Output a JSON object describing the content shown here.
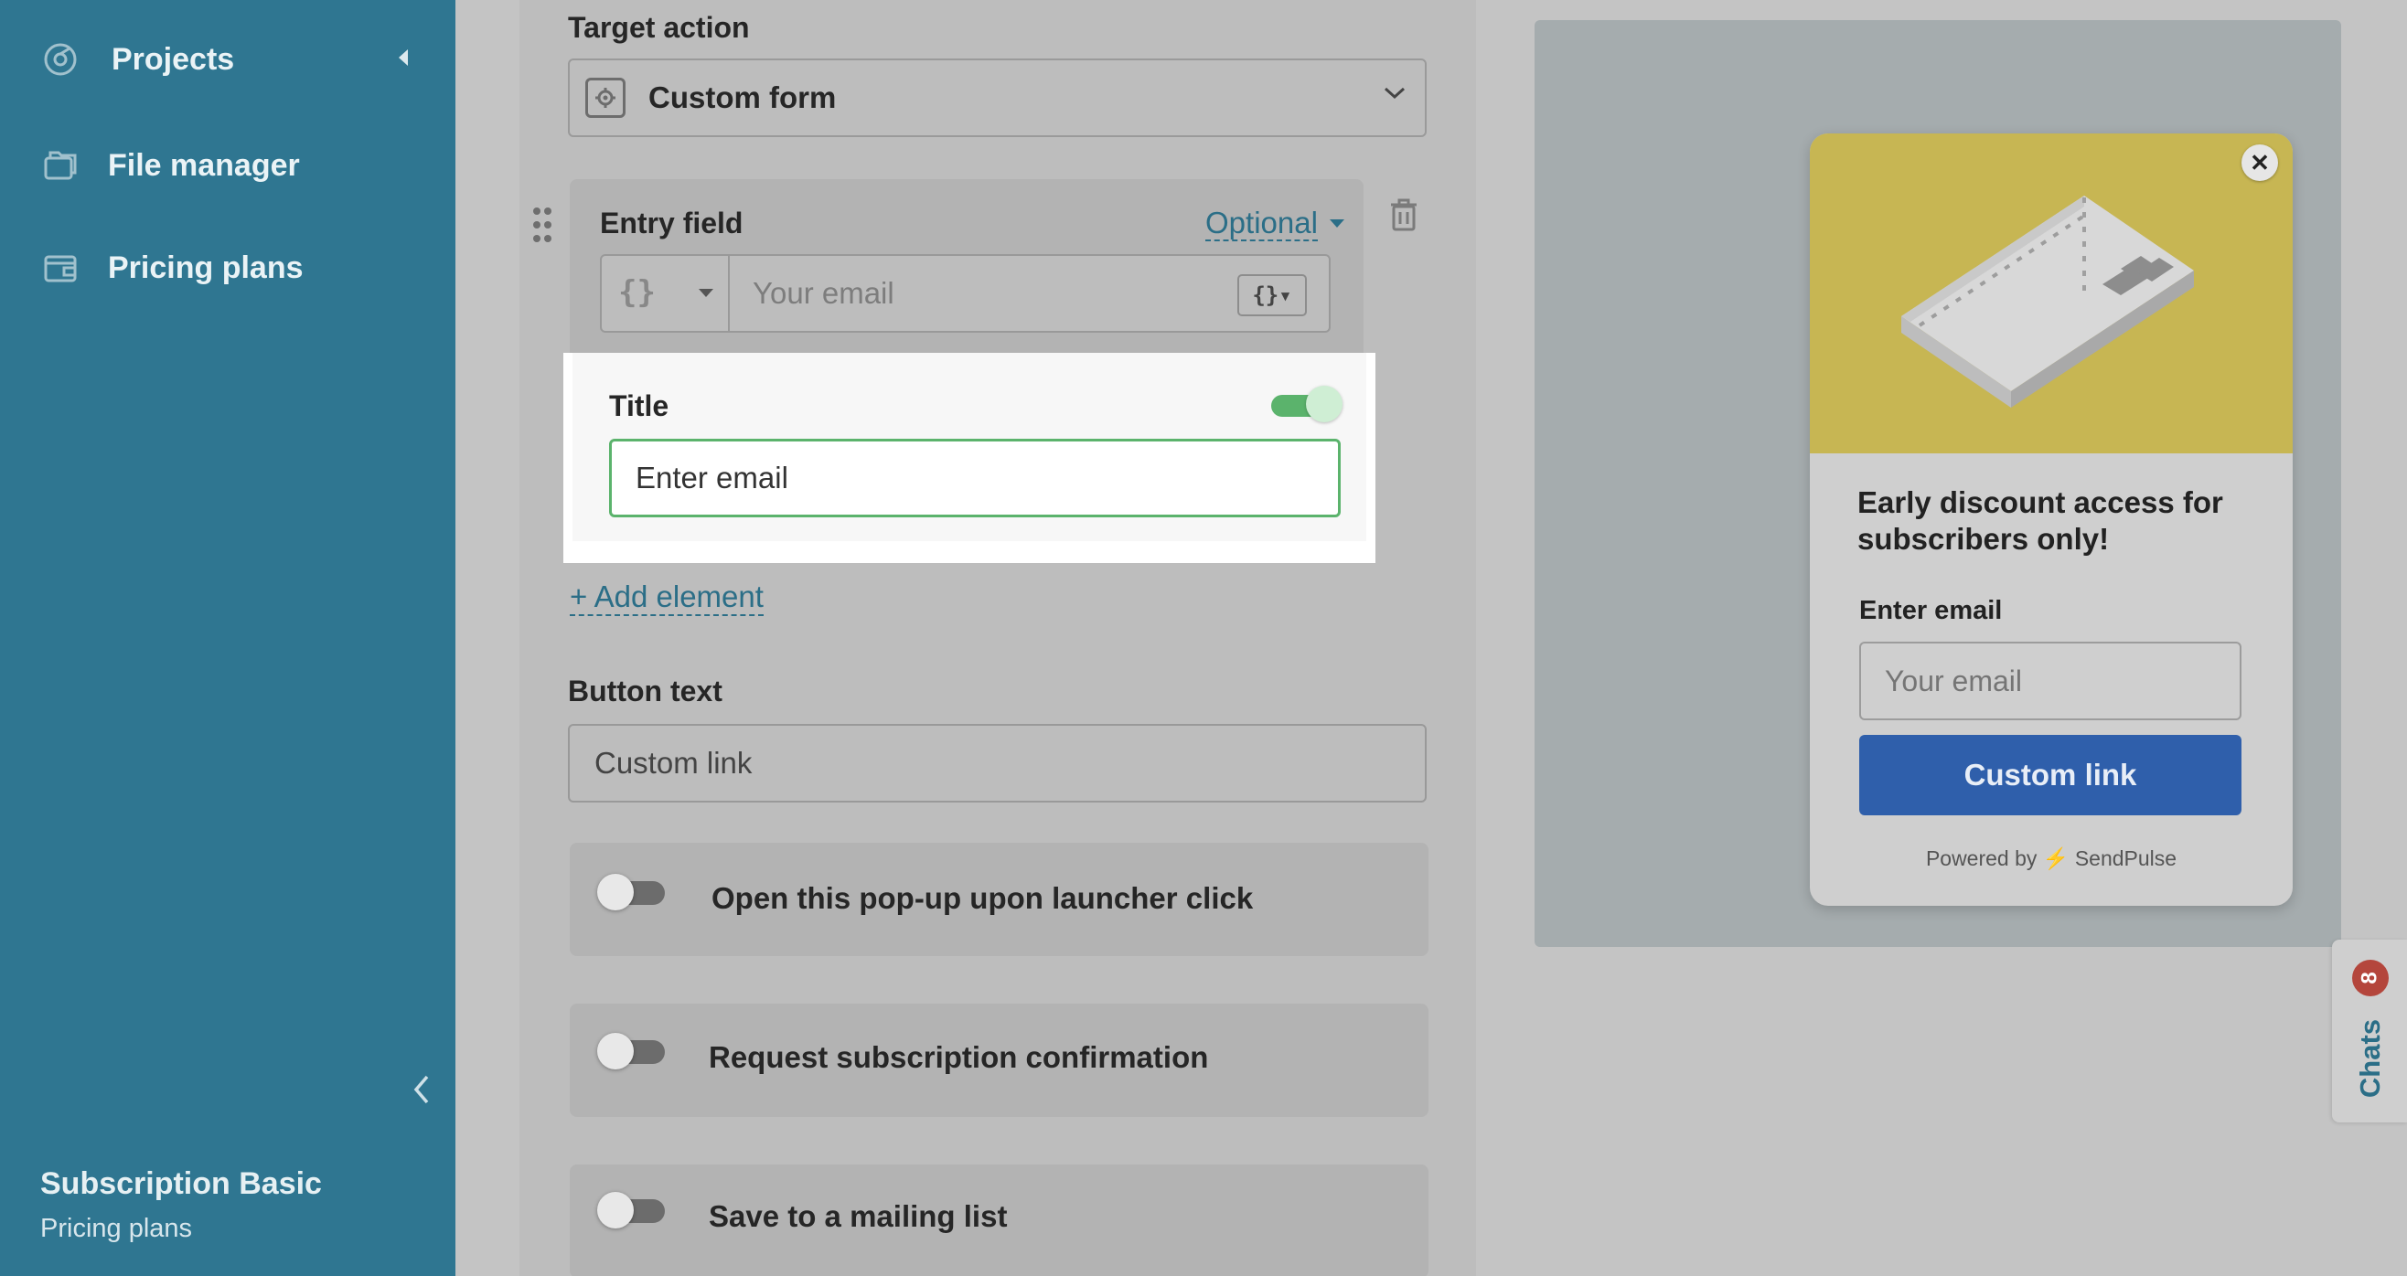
{
  "sidebar": {
    "items": [
      {
        "label": "Projects",
        "icon": "projects-icon"
      },
      {
        "label": "File manager",
        "icon": "folders-icon"
      },
      {
        "label": "Pricing plans",
        "icon": "wallet-icon"
      }
    ],
    "plan_name": "Subscription Basic",
    "plan_sub": "Pricing plans"
  },
  "editor": {
    "target_action_label": "Target action",
    "target_action_value": "Custom form",
    "entry_field": {
      "label": "Entry field",
      "optional_label": "Optional",
      "variable_braces": "{}",
      "placeholder": "Your email",
      "insert_btn": "{}▾"
    },
    "title_field": {
      "label": "Title",
      "value": "Enter email",
      "toggle_on": true
    },
    "add_element": "+ Add element",
    "button_text_label": "Button text",
    "button_text_value": "Custom link",
    "options": [
      {
        "label": "Open this pop-up upon launcher click",
        "on": false
      },
      {
        "label": "Request subscription confirmation",
        "on": false
      },
      {
        "label": "Save to a mailing list",
        "on": false
      }
    ]
  },
  "preview": {
    "close": "✕",
    "heading": "Early discount access for subscribers only!",
    "field_label": "Enter email",
    "field_placeholder": "Your email",
    "button": "Custom link",
    "powered": "Powered by ⚡ SendPulse",
    "colors": {
      "banner": "#c7b653",
      "button": "#2f5fab"
    }
  },
  "chats": {
    "label": "Chats",
    "count": "8"
  }
}
